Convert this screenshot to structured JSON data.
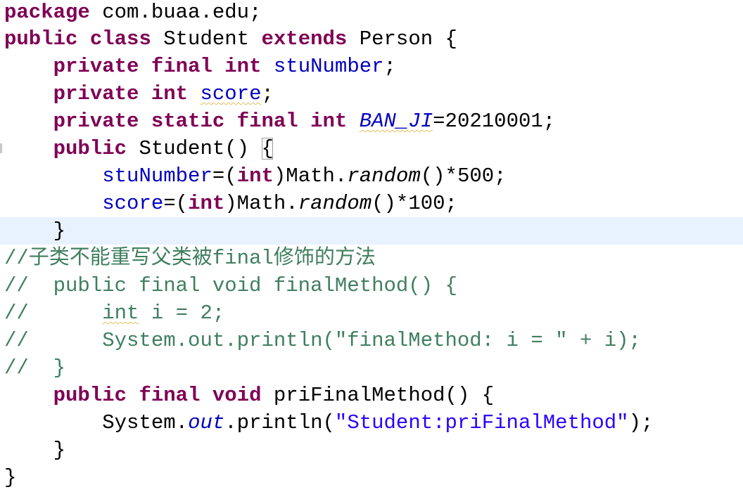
{
  "code": {
    "l1": {
      "kw": "package",
      "rest": " com.buaa.edu;"
    },
    "l2": {
      "kw1": "public",
      "kw2": "class",
      "mid": " Student ",
      "kw3": "extends",
      "rest": " Person {"
    },
    "l3": {
      "indent": "    ",
      "kw1": "private",
      "kw2": "final",
      "kw3": "int",
      "field": "stuNumber",
      "rest": ";"
    },
    "l4": {
      "indent": "    ",
      "kw1": "private",
      "kw2": "int",
      "field": "score",
      "rest": ";"
    },
    "l5": {
      "indent": "    ",
      "kw1": "private",
      "kw2": "static",
      "kw3": "final",
      "kw4": "int",
      "field": "BAN_JI",
      "rest": "=20210001;"
    },
    "l6": {
      "indent": "    ",
      "kw": "public",
      "mid": " Student() ",
      "brace": "{"
    },
    "l7": {
      "indent": "        ",
      "field": "stuNumber",
      "p1": "=(",
      "kw": "int",
      "p2": ")Math.",
      "method": "random",
      "rest": "()*500;"
    },
    "l8": {
      "indent": "        ",
      "field": "score",
      "p1": "=(",
      "kw": "int",
      "p2": ")Math.",
      "method": "random",
      "rest": "()*100;"
    },
    "l9": {
      "text": "    }"
    },
    "l10": {
      "text": "//子类不能重写父类被final修饰的方法"
    },
    "l11": {
      "text": "//  public final void finalMethod() {"
    },
    "l12": {
      "prefix": "//      ",
      "squig": "int",
      "rest": " i = 2;"
    },
    "l13": {
      "text": "//      System.out.println(\"finalMethod: i = \" + i);"
    },
    "l14": {
      "text": "//  }"
    },
    "l15": {
      "indent": "    ",
      "kw1": "public",
      "kw2": "final",
      "kw3": "void",
      "rest": " priFinalMethod() {"
    },
    "l16": {
      "indent": "        ",
      "p1": "System.",
      "out": "out",
      "p2": ".println(",
      "str": "\"Student:priFinalMethod\"",
      "rest": ");"
    },
    "l17": {
      "text": "    }"
    },
    "l18": {
      "text": "}"
    }
  },
  "colors": {
    "keyword": "#7f0055",
    "field": "#0000c0",
    "string": "#2a00ff",
    "comment": "#3f7f5f",
    "current_line": "#e8f2fe"
  }
}
